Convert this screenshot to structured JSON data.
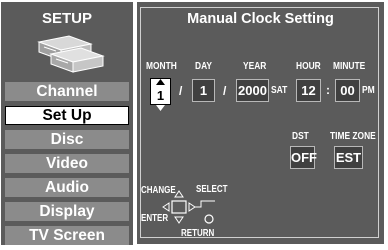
{
  "left_panel": {
    "title": "SETUP",
    "icon": "av-devices-icon",
    "menu": [
      {
        "label": "Channel",
        "selected": false
      },
      {
        "label": "Set Up",
        "selected": true
      },
      {
        "label": "Disc",
        "selected": false
      },
      {
        "label": "Video",
        "selected": false
      },
      {
        "label": "Audio",
        "selected": false
      },
      {
        "label": "Display",
        "selected": false
      },
      {
        "label": "TV Screen",
        "selected": false
      }
    ]
  },
  "clock": {
    "title": "Manual Clock Setting",
    "labels": {
      "month": "MONTH",
      "day": "DAY",
      "year": "YEAR",
      "hour": "HOUR",
      "minute": "MINUTE",
      "dst": "DST",
      "time_zone": "TIME ZONE"
    },
    "values": {
      "month": "1",
      "day": "1",
      "year": "2000",
      "weekday": "SAT",
      "hour": "12",
      "minute": "00",
      "ampm": "PM",
      "dst": "OFF",
      "time_zone": "EST"
    },
    "separators": {
      "date": "/",
      "time": ":"
    }
  },
  "nav_hint": {
    "change": "CHANGE",
    "select": "SELECT",
    "enter": "ENTER",
    "return": "RETURN"
  },
  "colors": {
    "panel": "#5b5b5b",
    "menu_item": "#8b8b8b",
    "selected": "#ffffff",
    "value_box": "#404040"
  }
}
